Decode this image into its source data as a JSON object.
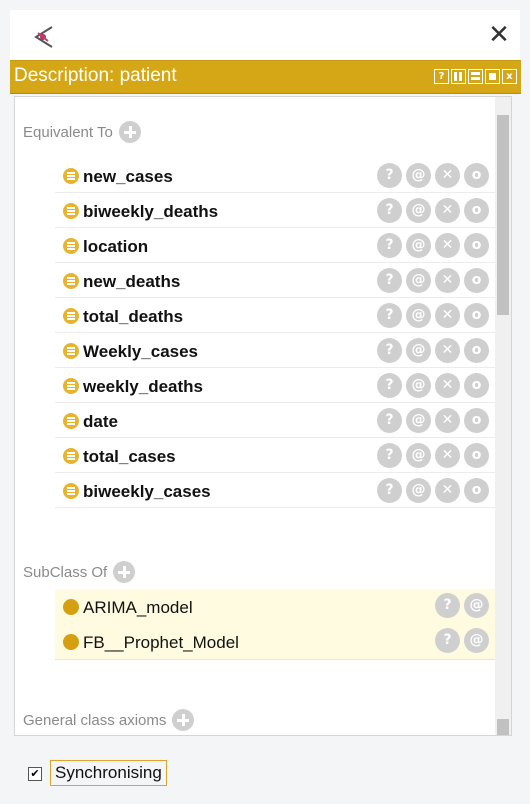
{
  "window": {
    "icon": "protege-logo-icon",
    "close_glyph": "✕"
  },
  "panel": {
    "title": "Description: patient",
    "header_buttons": [
      "?",
      "",
      "",
      "",
      "x"
    ]
  },
  "equivalent": {
    "label": "Equivalent To",
    "items": [
      {
        "label": "new_cases"
      },
      {
        "label": "biweekly_deaths"
      },
      {
        "label": "location"
      },
      {
        "label": "new_deaths"
      },
      {
        "label": "total_deaths"
      },
      {
        "label": "Weekly_cases"
      },
      {
        "label": "weekly_deaths"
      },
      {
        "label": "date"
      },
      {
        "label": "total_cases"
      },
      {
        "label": "biweekly_cases"
      }
    ],
    "actions": [
      "?",
      "@",
      "✕",
      "o"
    ]
  },
  "subclass": {
    "label": "SubClass Of",
    "items": [
      {
        "label": "ARIMA_model"
      },
      {
        "label": "FB__Prophet_Model"
      }
    ],
    "actions": [
      "?",
      "@"
    ]
  },
  "general": {
    "label": "General class axioms"
  },
  "footer": {
    "checkbox_checked": true,
    "check_glyph": "✔",
    "sync_label": "Synchronising"
  },
  "colors": {
    "header": "#d5a716",
    "property_icon": "#e8b430",
    "class_icon": "#d59f12",
    "subclass_bg": "#fffbe0"
  }
}
